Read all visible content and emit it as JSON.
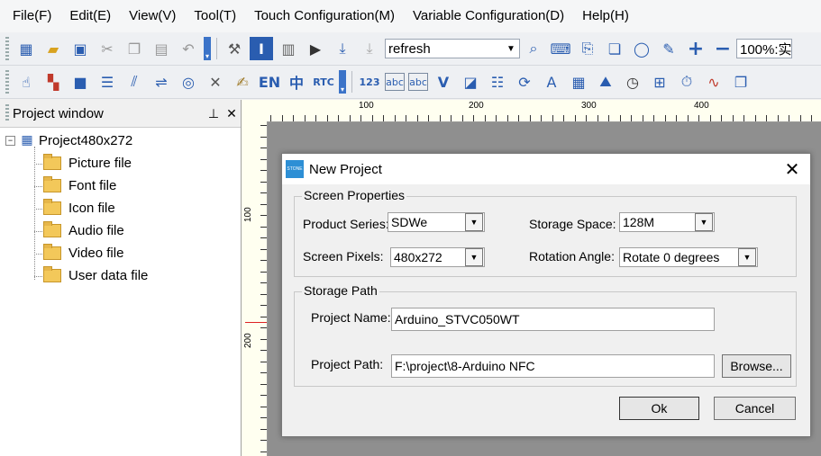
{
  "menubar": {
    "items": [
      "File(F)",
      "Edit(E)",
      "View(V)",
      "Tool(T)",
      "Touch Configuration(M)",
      "Variable Configuration(D)",
      "Help(H)"
    ]
  },
  "toolbar1": {
    "combo_value": "refresh",
    "zoom_value": "100%:实"
  },
  "toolbar2": {
    "en_label": "EN",
    "zh_label": "中",
    "rtc_label": "RTC",
    "num_label": "123",
    "abc_label": "abc"
  },
  "project_window": {
    "title": "Project window",
    "root": "Project480x272",
    "children": [
      "Picture file",
      "Font file",
      "Icon file",
      "Audio file",
      "Video file",
      "User data file"
    ]
  },
  "ruler": {
    "h_labels": [
      "100",
      "200",
      "300",
      "400"
    ],
    "v_labels": [
      "100",
      "200"
    ]
  },
  "dialog": {
    "logo_text": "STONE",
    "title": "New Project",
    "screen_properties": {
      "title": "Screen Properties",
      "product_series_label": "Product Series:",
      "product_series_value": "SDWe",
      "storage_space_label": "Storage Space:",
      "storage_space_value": "128M",
      "screen_pixels_label": "Screen Pixels:",
      "screen_pixels_value": "480x272",
      "rotation_angle_label": "Rotation Angle:",
      "rotation_angle_value": "Rotate 0 degrees"
    },
    "storage_path": {
      "title": "Storage Path",
      "project_name_label": "Project Name:",
      "project_name_value": "Arduino_STVC050WT",
      "project_path_label": "Project Path:",
      "project_path_value": "F:\\project\\8-Arduino NFC",
      "browse_label": "Browse..."
    },
    "ok_label": "Ok",
    "cancel_label": "Cancel"
  }
}
